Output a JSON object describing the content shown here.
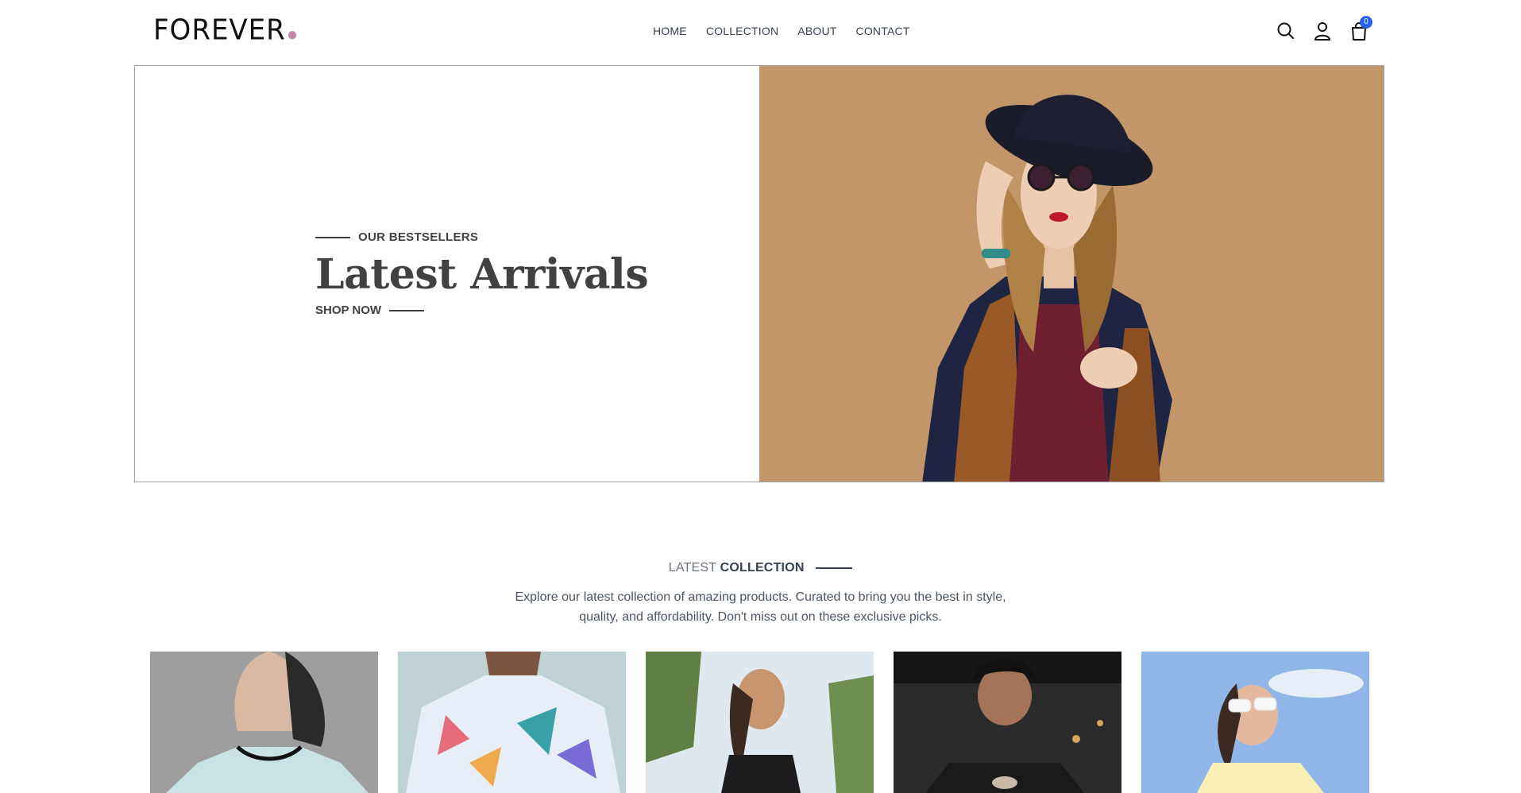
{
  "header": {
    "logo_text": "FOREVER",
    "nav": [
      {
        "label": "HOME"
      },
      {
        "label": "COLLECTION"
      },
      {
        "label": "ABOUT"
      },
      {
        "label": "CONTACT"
      }
    ],
    "icons": [
      "search-icon",
      "user-icon",
      "cart-icon"
    ],
    "cart_count": "0"
  },
  "hero": {
    "eyebrow": "OUR BESTSELLERS",
    "title": "Latest Arrivals",
    "cta": "SHOP NOW",
    "image_alt": "model-with-hat-and-sunglasses"
  },
  "latest_collection": {
    "title_light": "LATEST",
    "title_bold": "COLLECTION",
    "description_line1": "Explore our latest collection of amazing products. Curated to bring you the best in style,",
    "description_line2": "quality, and affordability. Don't miss out on these exclusive picks."
  },
  "colors": {
    "accent_dot": "#c586a5",
    "badge": "#2563eb",
    "hero_bg": "#c3966a",
    "text": "#414141"
  }
}
